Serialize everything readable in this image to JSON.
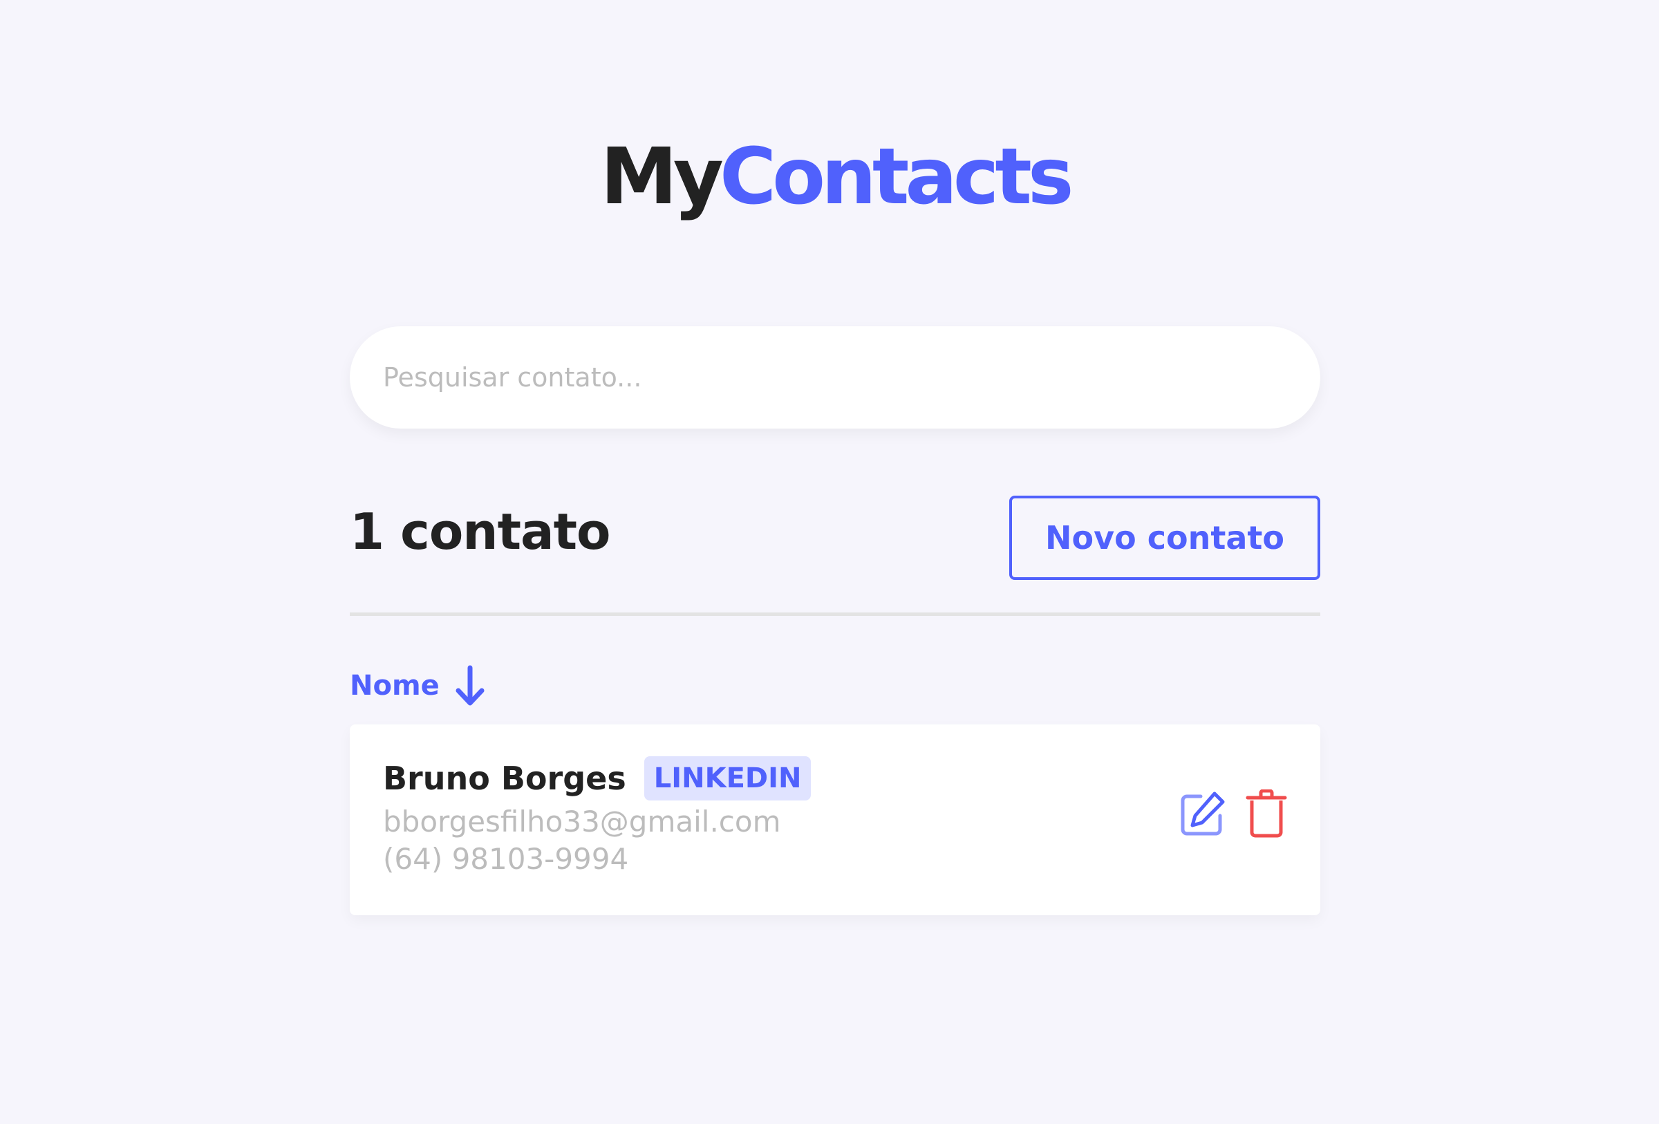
{
  "header": {
    "logo_part1": "My",
    "logo_part2": "Contacts"
  },
  "search": {
    "placeholder": "Pesquisar contato...",
    "value": ""
  },
  "toolbar": {
    "count_label": "1 contato",
    "new_contact_label": "Novo contato"
  },
  "sort": {
    "label": "Nome",
    "icon": "arrow-down-icon",
    "direction": "asc"
  },
  "contacts": [
    {
      "name": "Bruno Borges",
      "category": "LINKEDIN",
      "email": "bborgesfilho33@gmail.com",
      "phone": "(64) 98103-9994"
    }
  ],
  "actions": {
    "edit_icon": "edit-icon",
    "delete_icon": "trash-icon"
  },
  "colors": {
    "background": "#f6f5fc",
    "primary": "#5061fc",
    "primary_light": "#e0e3ff",
    "text": "#222222",
    "muted": "#bcbcbc",
    "danger": "#f04d4d",
    "edit_light": "#8b96fd"
  }
}
